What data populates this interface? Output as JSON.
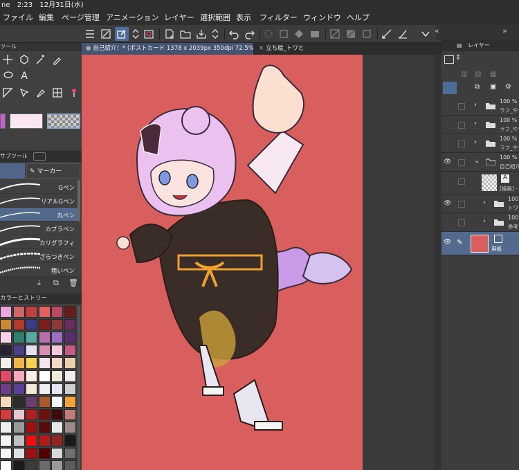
{
  "status": {
    "carrier": "ne",
    "time": "2:23",
    "date": "12月31日(水)"
  },
  "menu": [
    "ファイル",
    "編集",
    "ページ管理",
    "アニメーション",
    "レイヤー",
    "選択範囲",
    "表示",
    "フィルター",
    "ウィンドウ",
    "ヘルプ"
  ],
  "tool_panel": {
    "header": "ツール",
    "text_tool_glyph": "A"
  },
  "subtool": {
    "tab_label": "サブツール",
    "category": "マーカー",
    "brushes": [
      "Gペン",
      "リアルGペン",
      "丸ペン",
      "カブラペン",
      "カリグラフィ",
      "ざらつきペン",
      "粗いペン"
    ],
    "selected": "丸ペン"
  },
  "color_history": {
    "header": "カラーヒストリー",
    "colors": [
      "#e9a7e0",
      "#d06666",
      "#c04040",
      "#e56060",
      "#b94a63",
      "#6a1b1b",
      "#c9883a",
      "#b33a2f",
      "#3d3a8c",
      "#7d1d1d",
      "#8e3a3a",
      "#6a2c5f",
      "#f7d2e6",
      "#2f7f6f",
      "#58a9a0",
      "#b86ea8",
      "#9a6fc4",
      "#5d2e6e",
      "#2c1f33",
      "#4d3f86",
      "#e7e0f5",
      "#d88fb5",
      "#f2c8dc",
      "#c65b87",
      "#f4f0ec",
      "#f0b64a",
      "#f6d34f",
      "#f3e4ef",
      "#f6d8c7",
      "#ead0ad",
      "#e04b6a",
      "#f6a9bf",
      "#f7efe3",
      "#ffffff",
      "#f2e8d8",
      "#f5e9f1",
      "#6e3e8a",
      "#5a3e97",
      "#f4ead6",
      "#f3f0f2",
      "#e6e6f2",
      "#cfcfcf",
      "#f9d8c0",
      "#2c2c2c",
      "#6b3c6f",
      "#a85b2e",
      "#f7f7f7",
      "#f2a43c",
      "#d33c3c",
      "#e8c6cf",
      "#b02020",
      "#6e1010",
      "#3a0c0c",
      "#c07d78",
      "#f0f0f0",
      "#9a9a9a",
      "#a01010",
      "#5a0b0b",
      "#e8e8e8",
      "#9a8a8a",
      "#f4f4f4",
      "#c0c0c0",
      "#e81010",
      "#b01c1c",
      "#8e2424",
      "#1a1a1a",
      "#f7f7f7",
      "#e0e0e0",
      "#a01010",
      "#500000",
      "#d8d8d8",
      "#707070",
      "#ffffff",
      "#1a1a1a",
      "#3a3a3a",
      "#6a6a6a",
      "#9a9a9a",
      "#5a5a5a"
    ]
  },
  "document_tabs": [
    {
      "label": "自己紹介！* (ポストカード 1378 x 2039px 350dpi 72.5%)",
      "active": true
    },
    {
      "label": "立ち絵_トワと",
      "active": false
    }
  ],
  "colors": {
    "paper": "#d95e5e",
    "selection": "#546a8c"
  },
  "layer_panel": {
    "tab_label": "レイヤー",
    "layers": [
      {
        "opacity": "100 %",
        "name": "ラフ_やり",
        "visible": false,
        "type": "folder"
      },
      {
        "opacity": "100 %",
        "name": "ラフ_やり",
        "visible": false,
        "type": "folder"
      },
      {
        "opacity": "100 %",
        "name": "ラフ_やり",
        "visible": false,
        "type": "folder"
      },
      {
        "opacity": "100 %",
        "name": "自己紹介",
        "visible": true,
        "type": "folder-open"
      },
      {
        "opacity": "",
        "name": "[線画] -",
        "visible": false,
        "type": "text"
      },
      {
        "opacity": "100",
        "name": "トワ",
        "visible": true,
        "type": "folder"
      },
      {
        "opacity": "100",
        "name": "参考",
        "visible": false,
        "type": "folder"
      },
      {
        "opacity": "",
        "name": "用紙",
        "visible": true,
        "type": "paper",
        "selected": true
      }
    ]
  }
}
